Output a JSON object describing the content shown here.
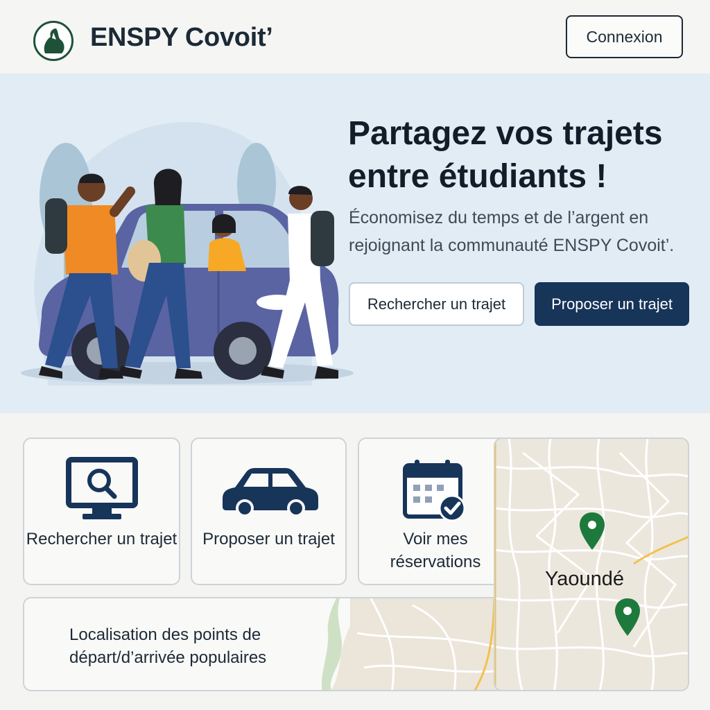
{
  "header": {
    "brand": "ENSPY Covoit’",
    "login_label": "Connexion"
  },
  "hero": {
    "title": "Partagez vos trajets entre étudiants !",
    "subtitle": "Économisez du temps et de l’argent en rejoignant la communauté ENSPY Covoit’.",
    "search_label": "Rechercher un trajet",
    "propose_label": "Proposer un trajet"
  },
  "cards": [
    {
      "label": "Rechercher un trajet",
      "icon": "monitor-search-icon"
    },
    {
      "label": "Proposer un trajet",
      "icon": "car-icon"
    },
    {
      "label": "Voir mes réservations",
      "icon": "calendar-check-icon"
    }
  ],
  "map": {
    "city": "Yaoundé",
    "caption": "Localisation des points de départ/d’arrivée populaires",
    "pin_icon": "map-pin-icon"
  },
  "colors": {
    "primary": "#173459",
    "hero_bg": "#e2ecf4",
    "pin": "#1e7a3c",
    "road": "#f2c14e"
  }
}
